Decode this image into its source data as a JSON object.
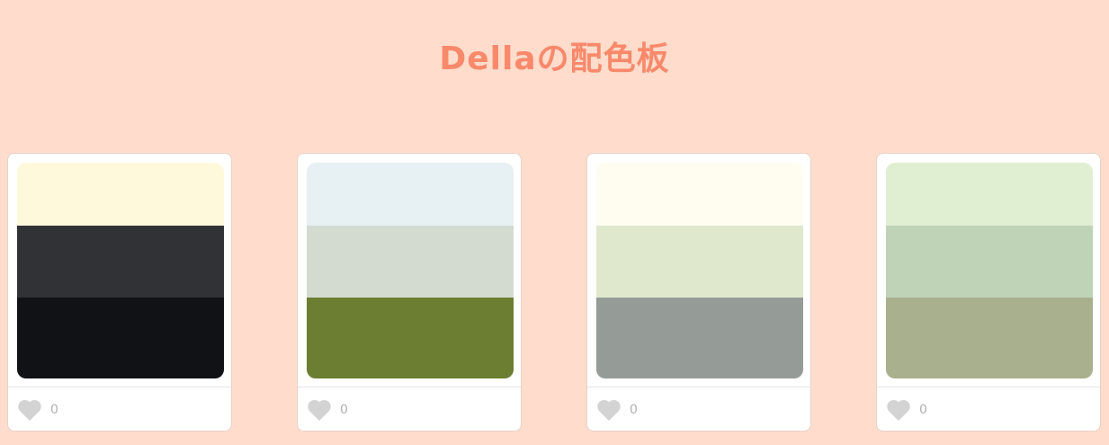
{
  "page": {
    "background": "#ffdccc",
    "title": "Dellaの配色板",
    "title_color": "#f9896b"
  },
  "palettes": [
    {
      "colors": [
        "#fff9dc",
        "#313235",
        "#111216"
      ],
      "likes": "0",
      "like_icon": "heart-icon"
    },
    {
      "colors": [
        "#e7f0f2",
        "#d3dbd1",
        "#6b7e31"
      ],
      "likes": "0",
      "like_icon": "heart-icon"
    },
    {
      "colors": [
        "#fffdf0",
        "#dfe8cd",
        "#959b96"
      ],
      "likes": "0",
      "like_icon": "heart-icon"
    },
    {
      "colors": [
        "#e0efd1",
        "#bfd3b6",
        "#a9b08e"
      ],
      "likes": "0",
      "like_icon": "heart-icon"
    }
  ],
  "icon_color": "#d3d3d3"
}
